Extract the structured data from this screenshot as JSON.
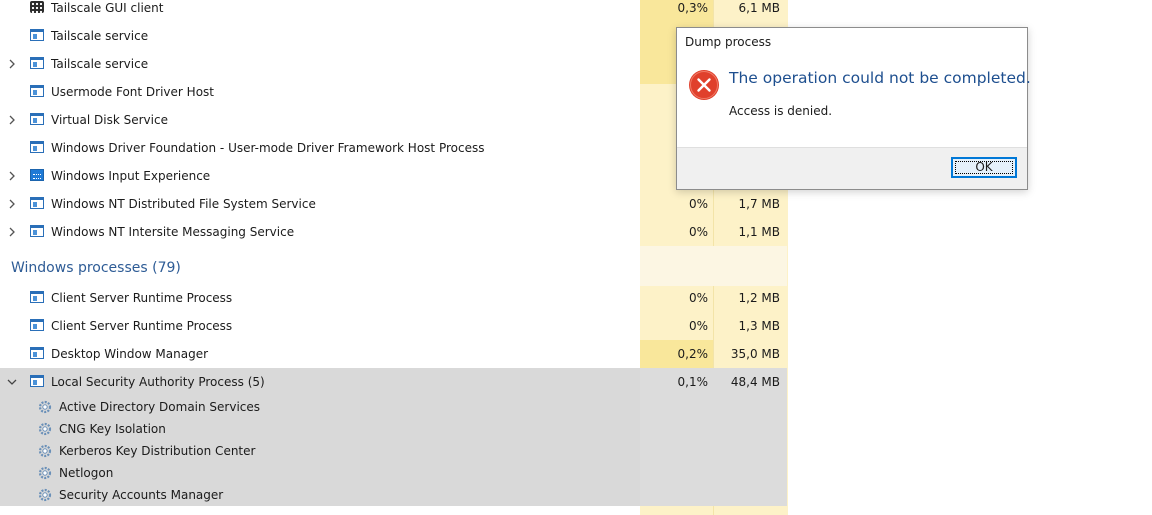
{
  "processes_top": [
    {
      "name": "Tailscale GUI client",
      "cpu": "0,3%",
      "mem": "6,1 MB",
      "icon": "app-grid-icon",
      "expandable": false
    },
    {
      "name": "Tailscale service",
      "cpu": "",
      "mem": "",
      "icon": "service-window-icon",
      "expandable": false
    },
    {
      "name": "Tailscale service",
      "cpu": "",
      "mem": "",
      "icon": "service-window-icon",
      "expandable": true
    },
    {
      "name": "Usermode Font Driver Host",
      "cpu": "",
      "mem": "",
      "icon": "service-window-icon",
      "expandable": false
    },
    {
      "name": "Virtual Disk Service",
      "cpu": "",
      "mem": "",
      "icon": "service-window-icon",
      "expandable": true
    },
    {
      "name": "Windows Driver Foundation - User-mode Driver Framework Host Process",
      "cpu": "",
      "mem": "",
      "icon": "service-window-icon",
      "expandable": false
    },
    {
      "name": "Windows Input Experience",
      "cpu": "",
      "mem": "",
      "icon": "keyboard-icon",
      "expandable": true
    },
    {
      "name": "Windows NT Distributed File System Service",
      "cpu": "0%",
      "mem": "1,7 MB",
      "icon": "service-window-icon",
      "expandable": true
    },
    {
      "name": "Windows NT Intersite Messaging Service",
      "cpu": "0%",
      "mem": "1,1 MB",
      "icon": "service-window-icon",
      "expandable": true
    }
  ],
  "group": {
    "label": "Windows processes (79)"
  },
  "processes_windows": [
    {
      "name": "Client Server Runtime Process",
      "cpu": "0%",
      "mem": "1,2 MB",
      "icon": "service-window-icon",
      "expandable": false
    },
    {
      "name": "Client Server Runtime Process",
      "cpu": "0%",
      "mem": "1,3 MB",
      "icon": "service-window-icon",
      "expandable": false
    },
    {
      "name": "Desktop Window Manager",
      "cpu": "0,2%",
      "mem": "35,0 MB",
      "icon": "service-window-icon",
      "expandable": false
    }
  ],
  "expanded": {
    "name": "Local Security Authority Process (5)",
    "cpu": "0,1%",
    "mem": "48,4 MB",
    "children": [
      "Active Directory Domain Services",
      "CNG Key Isolation",
      "Kerberos Key Distribution Center",
      "Netlogon",
      "Security Accounts Manager"
    ]
  },
  "dialog": {
    "title": "Dump process",
    "main_message": "The operation could not be completed.",
    "sub_message": "Access is denied.",
    "ok_label": "OK"
  },
  "colors": {
    "accent": "#0078d7",
    "heading": "#2e5c96",
    "error": "#e0402c",
    "column_tint": "#fdf2c8"
  }
}
